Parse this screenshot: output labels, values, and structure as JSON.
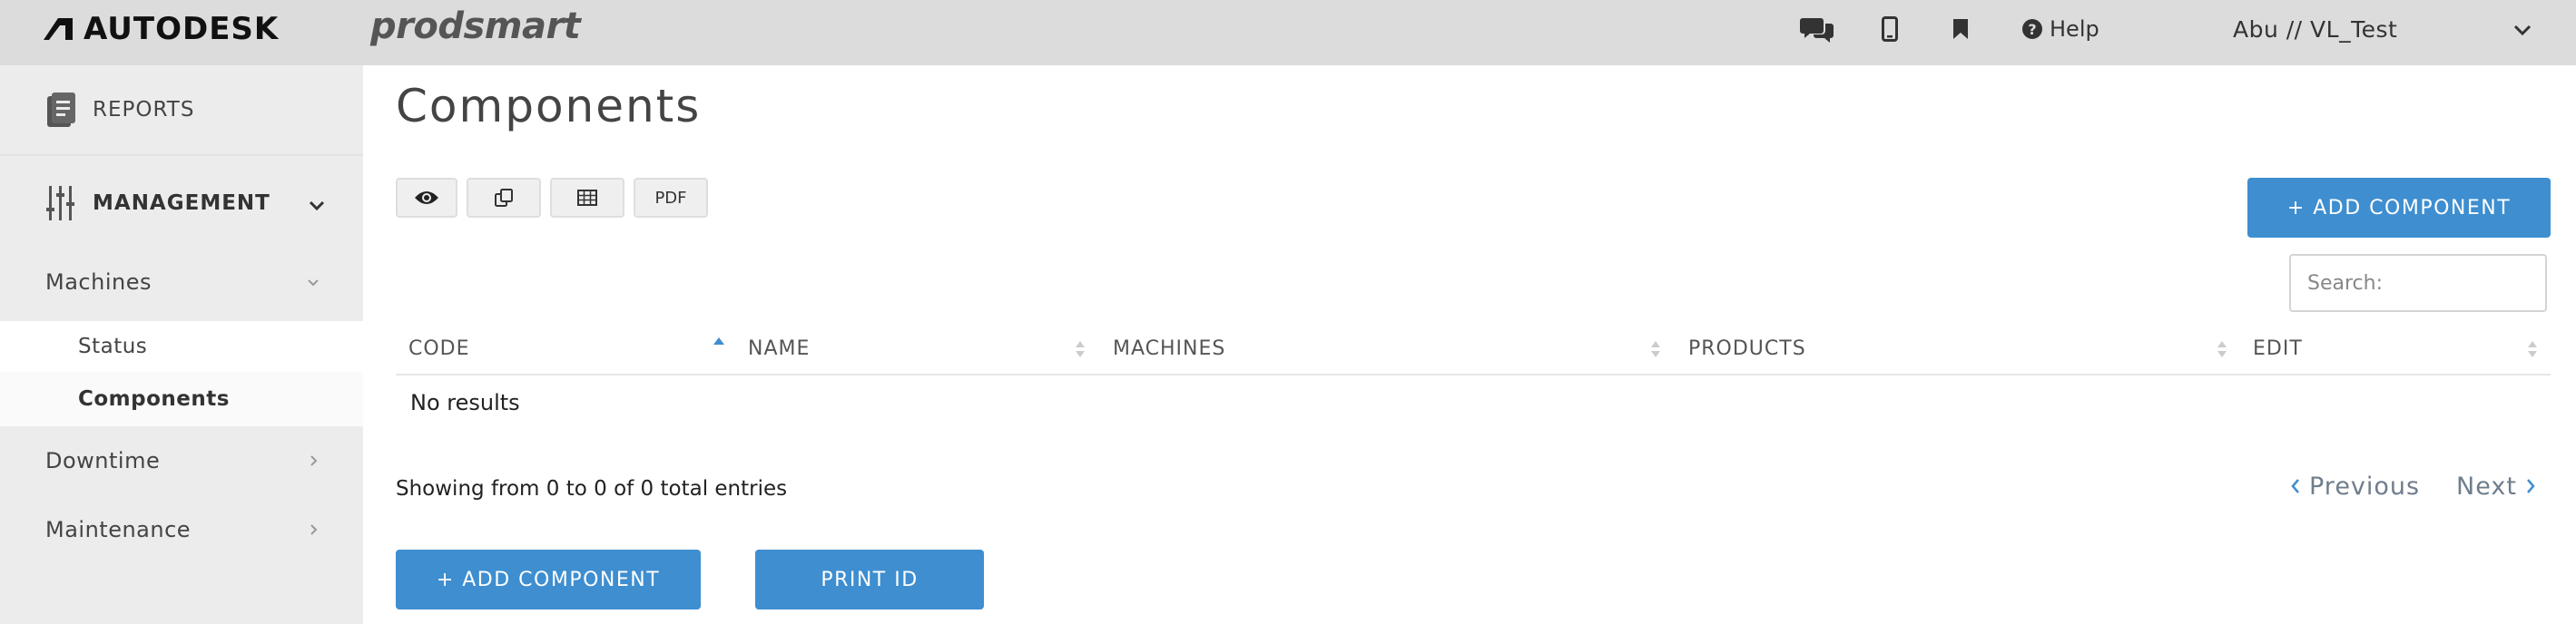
{
  "header": {
    "brand": "AUTODESK",
    "product": "prodsmart",
    "icons": [
      "chat-icon",
      "mobile-icon",
      "bookmark-icon"
    ],
    "help_label": "Help",
    "user_label": "Abu // VL_Test"
  },
  "sidebar": {
    "reports_label": "REPORTS",
    "management_label": "MANAGEMENT",
    "items": [
      {
        "label": "Machines",
        "expanded": true
      },
      {
        "label": "Downtime",
        "expanded": false
      },
      {
        "label": "Maintenance",
        "expanded": false
      }
    ],
    "machines_sub": [
      {
        "label": "Status",
        "active": false
      },
      {
        "label": "Components",
        "active": true
      }
    ]
  },
  "main": {
    "title": "Components",
    "toolbar": {
      "pdf_label": "PDF",
      "icons": [
        "eye-icon",
        "copy-icon",
        "table-icon"
      ]
    },
    "add_component_label": "+ ADD COMPONENT",
    "search_placeholder": "Search:",
    "table": {
      "columns": [
        "CODE",
        "NAME",
        "MACHINES",
        "PRODUCTS",
        "EDIT"
      ],
      "sorted_column": "CODE",
      "sort_direction": "ascending",
      "empty_text": "No results"
    },
    "info_text": "Showing from 0 to 0 of 0 total entries",
    "pagination": {
      "previous": "Previous",
      "next": "Next"
    },
    "bottom_buttons": {
      "add": "+ ADD COMPONENT",
      "print": "PRINT ID"
    }
  },
  "colors": {
    "topbar": "#dcdcdc",
    "sidebar": "#ececec",
    "primary": "#3e8ed0",
    "sort_active": "#3e8ed0"
  }
}
